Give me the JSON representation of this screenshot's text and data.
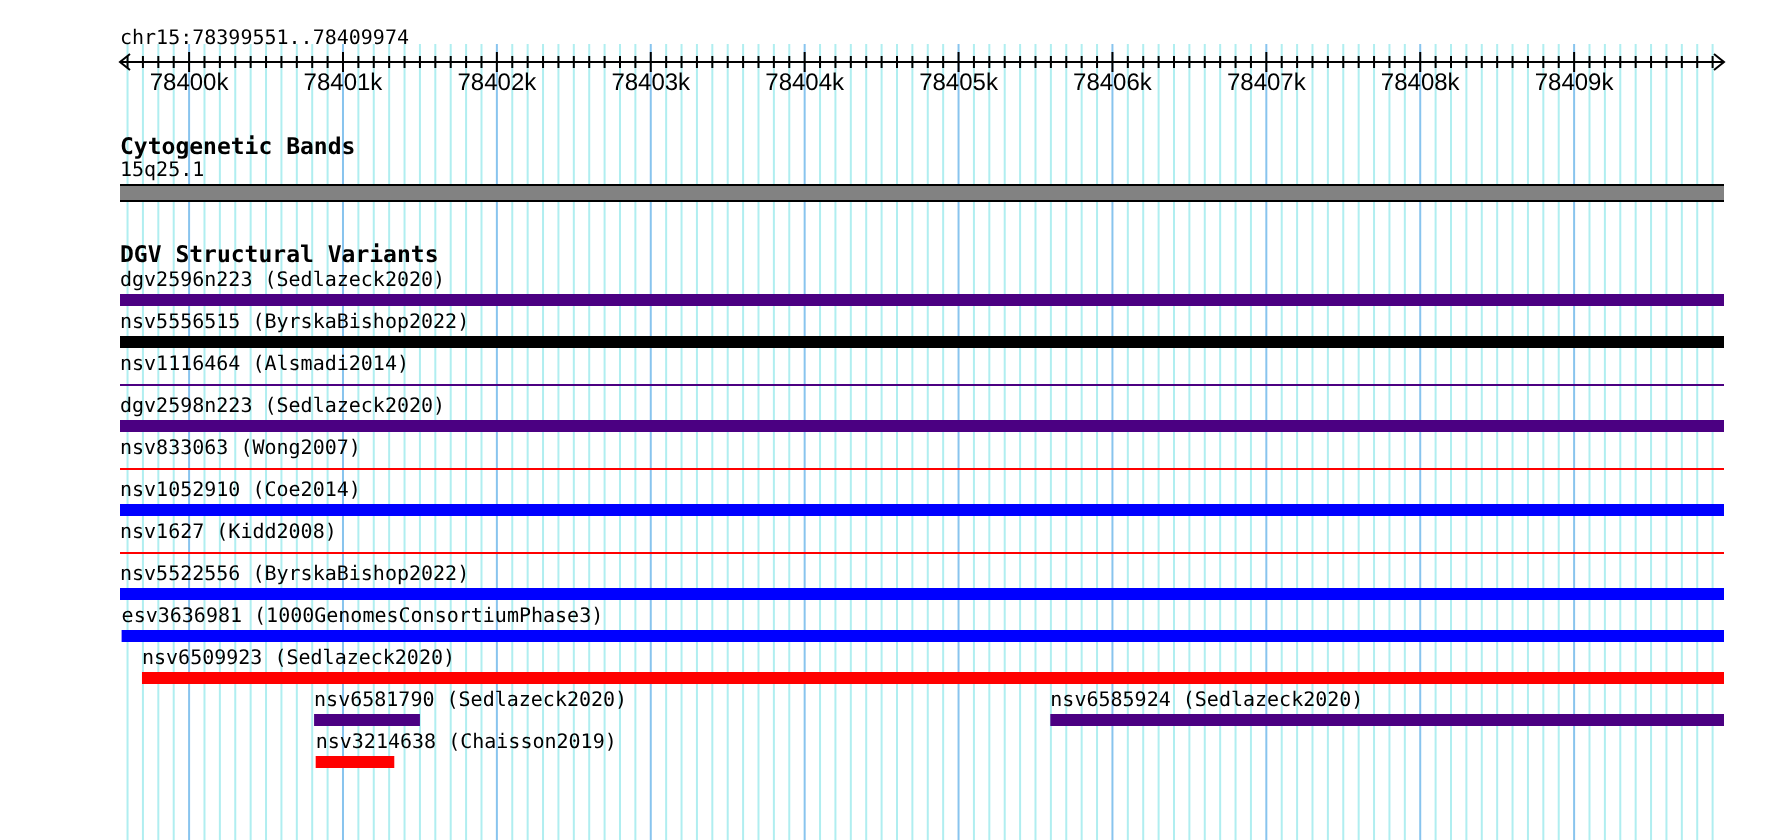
{
  "position": "chr15:78399551..78409974",
  "ruler": {
    "labels": [
      "78400k",
      "78401k",
      "78402k",
      "78403k",
      "78404k",
      "78405k",
      "78406k",
      "78407k",
      "78408k",
      "78409k"
    ]
  },
  "cytobands": {
    "title": "Cytogenetic Bands",
    "band": "15q25.1"
  },
  "variants": {
    "title": "DGV Structural Variants",
    "rows": [
      [
        {
          "label": "dgv2596n223 (Sedlazeck2020)",
          "color": "#4b0082",
          "kind": "thick"
        }
      ],
      [
        {
          "label": "nsv5556515 (ByrskaBishop2022)",
          "color": "#000000",
          "kind": "thick"
        }
      ],
      [
        {
          "label": "nsv1116464 (Alsmadi2014)",
          "color": "#4b0082",
          "kind": "thin"
        }
      ],
      [
        {
          "label": "dgv2598n223 (Sedlazeck2020)",
          "color": "#4b0082",
          "kind": "thick"
        }
      ],
      [
        {
          "label": "nsv833063 (Wong2007)",
          "color": "#ff0000",
          "kind": "thin"
        }
      ],
      [
        {
          "label": "nsv1052910 (Coe2014)",
          "color": "#0000ff",
          "kind": "thick"
        }
      ],
      [
        {
          "label": "nsv1627 (Kidd2008)",
          "color": "#ff0000",
          "kind": "thin"
        }
      ],
      [
        {
          "label": "nsv5522556 (ByrskaBishop2022)",
          "color": "#0000ff",
          "kind": "thick"
        }
      ],
      [
        {
          "label": "esv3636981 (1000GenomesConsortiumPhase3)",
          "color": "#0000ff",
          "kind": "thick"
        }
      ],
      [
        {
          "label": "nsv6509923 (Sedlazeck2020)",
          "color": "#ff0000",
          "kind": "thick"
        }
      ],
      [
        {
          "label": "nsv6581790 (Sedlazeck2020)",
          "color": "#4b0082",
          "kind": "thick"
        },
        {
          "label": "nsv6585924 (Sedlazeck2020)",
          "color": "#4b0082",
          "kind": "thick"
        }
      ],
      [
        {
          "label": "nsv3214638 (Chaisson2019)",
          "color": "#ff0000",
          "kind": "thick"
        }
      ]
    ]
  }
}
